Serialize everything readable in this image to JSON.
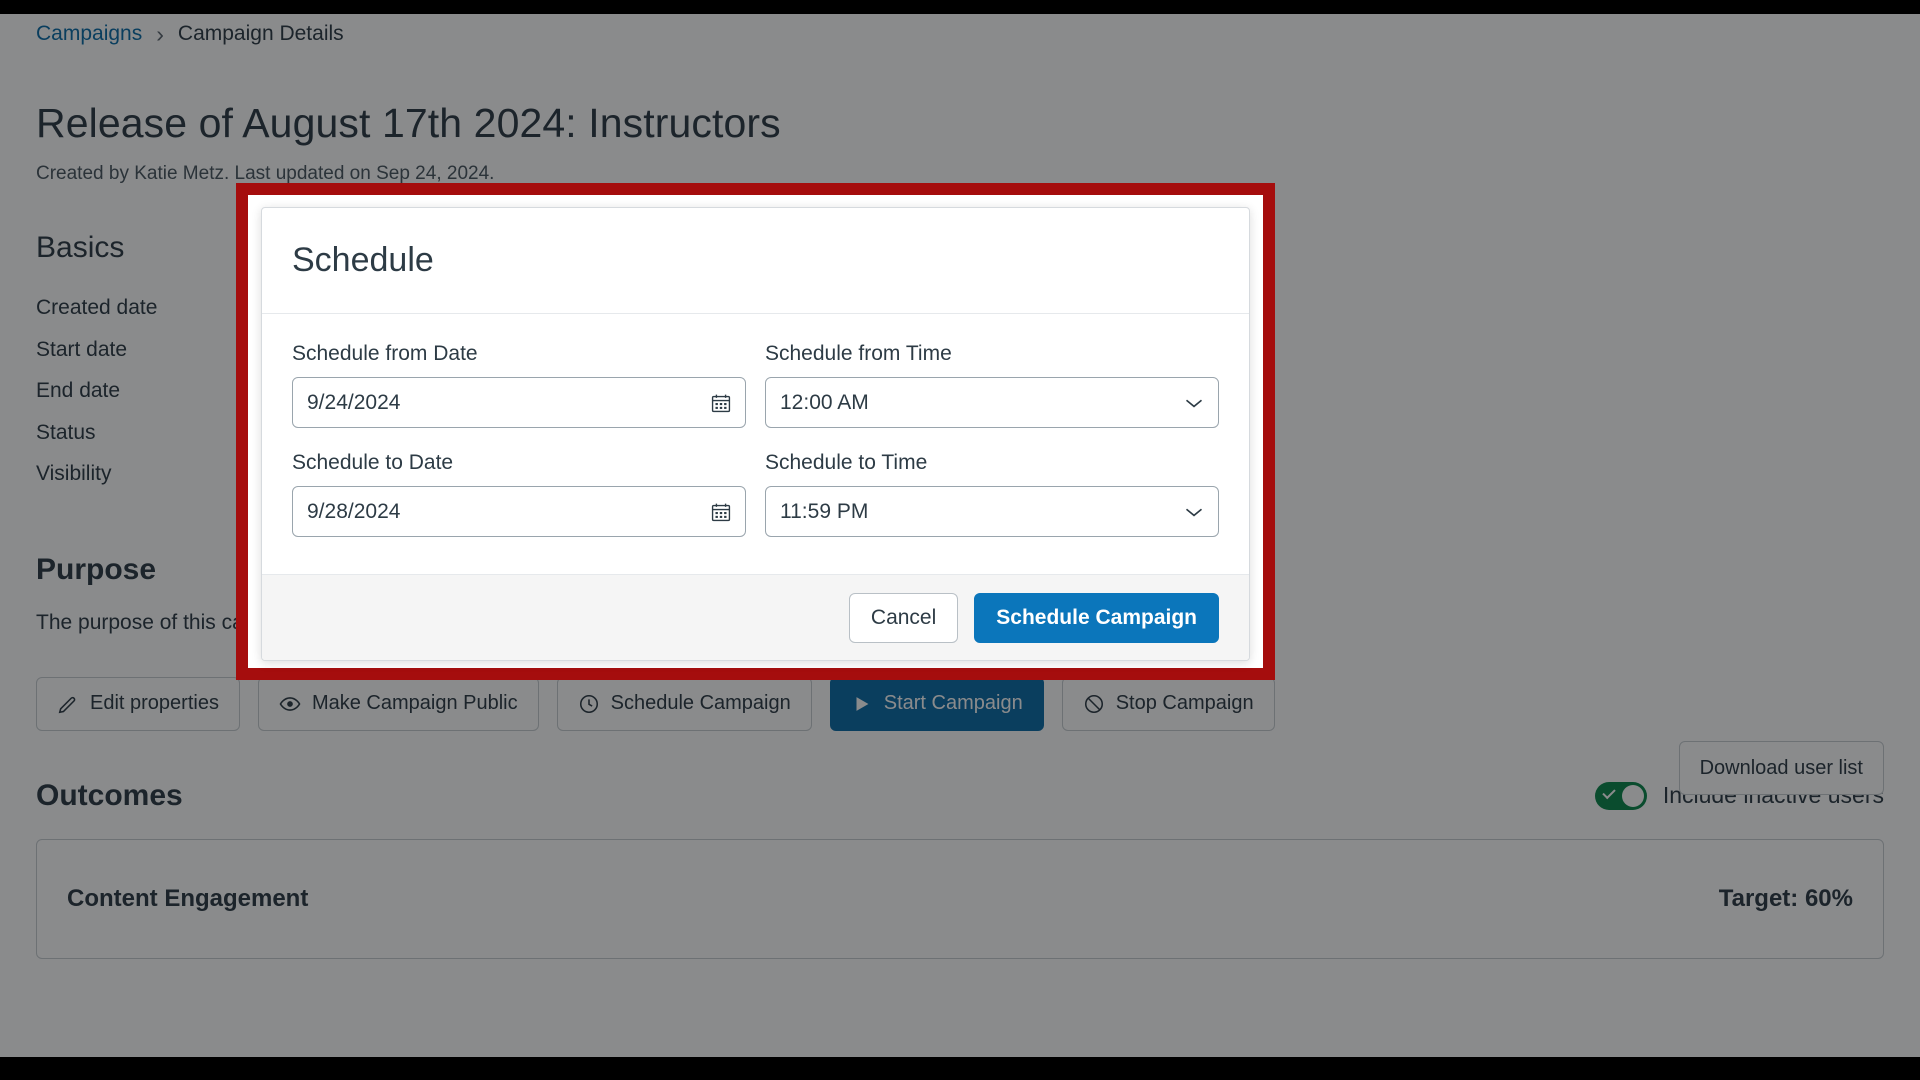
{
  "breadcrumb": {
    "parent": "Campaigns",
    "separator": "›",
    "current": "Campaign Details"
  },
  "page": {
    "title": "Release of August 17th 2024: Instructors",
    "subtitle": "Created by Katie Metz. Last updated on Sep 24, 2024.",
    "basics_heading": "Basics",
    "basics_rows": [
      {
        "label": "Created date"
      },
      {
        "label": "Start date"
      },
      {
        "label": "End date"
      },
      {
        "label": "Status"
      },
      {
        "label": "Visibility"
      }
    ],
    "purpose_heading": "Purpose",
    "purpose_text": "The purpose of this campaign is to inform instructors about the release update of August 17th, 2024.",
    "download_button": "Download user list",
    "actions": [
      {
        "label": "Edit properties",
        "icon": "pencil-icon",
        "primary": false
      },
      {
        "label": "Make Campaign Public",
        "icon": "eye-icon",
        "primary": false
      },
      {
        "label": "Schedule Campaign",
        "icon": "clock-icon",
        "primary": false
      },
      {
        "label": "Start Campaign",
        "icon": "play-icon",
        "primary": true
      },
      {
        "label": "Stop Campaign",
        "icon": "ban-icon",
        "primary": false
      }
    ],
    "outcomes_heading": "Outcomes",
    "toggle": {
      "label": "Include inactive users",
      "checked": true,
      "color": "#0b874b"
    },
    "outcome_card": {
      "name": "Content Engagement",
      "target": "Target: 60%"
    }
  },
  "modal": {
    "title": "Schedule",
    "fields": [
      {
        "label": "Schedule from Date",
        "value": "9/24/2024",
        "kind": "date",
        "adorn_icon": "calendar-icon"
      },
      {
        "label": "Schedule from Time",
        "value": "12:00 AM",
        "kind": "select",
        "adorn_icon": "chevron-down-icon"
      },
      {
        "label": "Schedule to Date",
        "value": "9/28/2024",
        "kind": "date",
        "adorn_icon": "calendar-icon"
      },
      {
        "label": "Schedule to Time",
        "value": "11:59 PM",
        "kind": "select",
        "adorn_icon": "chevron-down-icon"
      }
    ],
    "cancel_label": "Cancel",
    "submit_label": "Schedule Campaign"
  },
  "colors": {
    "highlight_border": "#a50d0d",
    "primary_button": "#0b76bb",
    "link": "#0b6ca8",
    "text": "#2d3b45",
    "toggle_on": "#0b874b"
  }
}
